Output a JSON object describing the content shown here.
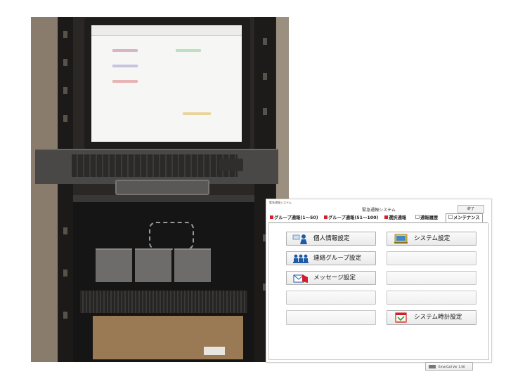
{
  "app": {
    "window_title": "緊急通報システム",
    "title": "緊急通報システム",
    "close_label": "終了",
    "colors": {
      "tab_red_mark": "#d0202a",
      "tab_gray_mark": "#9a9a9a",
      "accent_blue": "#1e5aa8",
      "accent_red": "#d0202a"
    },
    "tabs": [
      {
        "label": "グループ通報(1～50)",
        "mark": "red"
      },
      {
        "label": "グループ通報(51～100)",
        "mark": "red"
      },
      {
        "label": "選択通報",
        "mark": "red"
      },
      {
        "label": "通報履歴",
        "mark": "gray"
      },
      {
        "label": "メンテナンス",
        "mark": "gray",
        "active": true
      }
    ],
    "buttons": {
      "personal_info": {
        "label": "個人情報設定",
        "icon": "person-card-icon"
      },
      "contact_group": {
        "label": "連絡グループ設定",
        "icon": "people-group-icon"
      },
      "message": {
        "label": "メッセージ設定",
        "icon": "envelope-icon"
      },
      "system": {
        "label": "システム設定",
        "icon": "computer-settings-icon"
      },
      "system_clock": {
        "label": "システム時計設定",
        "icon": "calendar-clock-icon"
      }
    },
    "version_label": "EmerCall Ver 1.00"
  }
}
